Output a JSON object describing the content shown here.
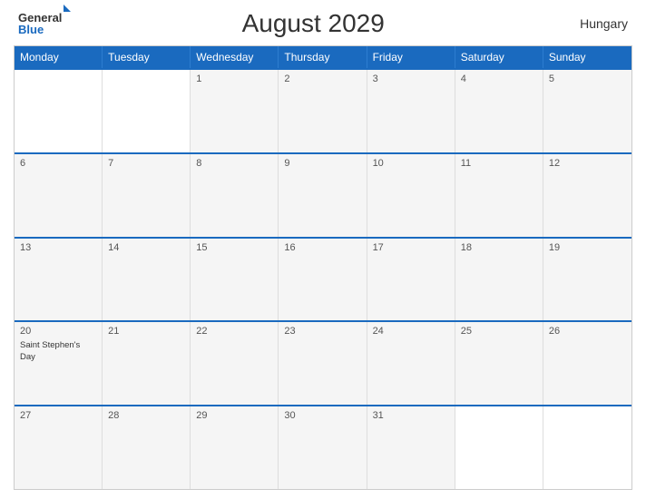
{
  "header": {
    "title": "August 2029",
    "country": "Hungary",
    "logo_general": "General",
    "logo_blue": "Blue"
  },
  "days_of_week": [
    "Monday",
    "Tuesday",
    "Wednesday",
    "Thursday",
    "Friday",
    "Saturday",
    "Sunday"
  ],
  "weeks": [
    [
      {
        "day": "",
        "empty": true
      },
      {
        "day": "",
        "empty": true
      },
      {
        "day": "1",
        "empty": false
      },
      {
        "day": "2",
        "empty": false
      },
      {
        "day": "3",
        "empty": false
      },
      {
        "day": "4",
        "empty": false
      },
      {
        "day": "5",
        "empty": false
      }
    ],
    [
      {
        "day": "6",
        "empty": false
      },
      {
        "day": "7",
        "empty": false
      },
      {
        "day": "8",
        "empty": false
      },
      {
        "day": "9",
        "empty": false
      },
      {
        "day": "10",
        "empty": false
      },
      {
        "day": "11",
        "empty": false
      },
      {
        "day": "12",
        "empty": false
      }
    ],
    [
      {
        "day": "13",
        "empty": false
      },
      {
        "day": "14",
        "empty": false
      },
      {
        "day": "15",
        "empty": false
      },
      {
        "day": "16",
        "empty": false
      },
      {
        "day": "17",
        "empty": false
      },
      {
        "day": "18",
        "empty": false
      },
      {
        "day": "19",
        "empty": false
      }
    ],
    [
      {
        "day": "20",
        "empty": false,
        "event": "Saint Stephen's Day"
      },
      {
        "day": "21",
        "empty": false
      },
      {
        "day": "22",
        "empty": false
      },
      {
        "day": "23",
        "empty": false
      },
      {
        "day": "24",
        "empty": false
      },
      {
        "day": "25",
        "empty": false
      },
      {
        "day": "26",
        "empty": false
      }
    ],
    [
      {
        "day": "27",
        "empty": false
      },
      {
        "day": "28",
        "empty": false
      },
      {
        "day": "29",
        "empty": false
      },
      {
        "day": "30",
        "empty": false
      },
      {
        "day": "31",
        "empty": false
      },
      {
        "day": "",
        "empty": true
      },
      {
        "day": "",
        "empty": true
      }
    ]
  ]
}
